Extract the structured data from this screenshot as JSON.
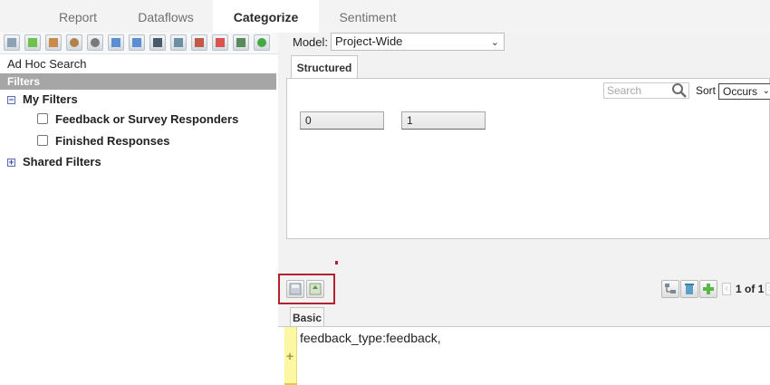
{
  "top_tabs": [
    {
      "label": "Report",
      "active": false
    },
    {
      "label": "Dataflows",
      "active": false
    },
    {
      "label": "Categorize",
      "active": true
    },
    {
      "label": "Sentiment",
      "active": false
    }
  ],
  "left": {
    "toolbar_icons": [
      "save-icon",
      "add-icon",
      "move-icon",
      "find-icon",
      "comment-icon",
      "move-top-icon",
      "move-bottom-icon",
      "hierarchy-icon",
      "grid-icon",
      "export-icon",
      "delete-icon",
      "report-icon",
      "refresh-icon"
    ],
    "adhoc_label": "Ad Hoc Search",
    "filters_header": "Filters",
    "my_filters": {
      "label": "My Filters",
      "items": [
        "Feedback or Survey Responders",
        "Finished Responses"
      ]
    },
    "shared_filters": {
      "label": "Shared Filters"
    }
  },
  "right": {
    "model_label": "Model:",
    "model_value": "Project-Wide",
    "structured_tab": "Structured",
    "search_placeholder": "Search",
    "sort_label": "Sort",
    "sort_value": "Occurs",
    "values": [
      "0",
      "1"
    ],
    "pagination": "1 of 1",
    "basic_tab": "Basic",
    "rule_text": "feedback_type:feedback,"
  },
  "colors": {
    "highlight_border": "#b3232f",
    "filters_header_bg": "#a6a6a6",
    "rule_bar": "#fbf7a3"
  }
}
